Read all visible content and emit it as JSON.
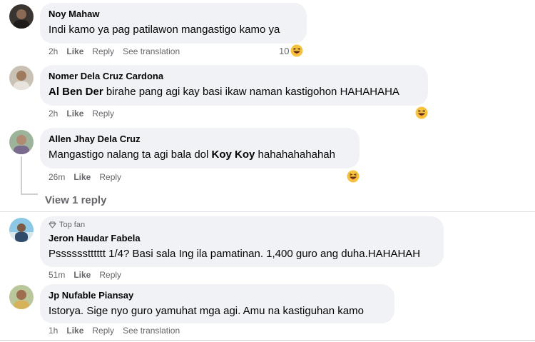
{
  "comments": [
    {
      "author": "Noy Mahaw",
      "text": "Indi kamo ya pag patilawon mangastigo kamo ya",
      "time": "2h",
      "like": "Like",
      "reply": "Reply",
      "see_translation": "See translation",
      "reaction_count": "10",
      "reaction_icon": "haha-icon"
    },
    {
      "author": "Nomer Dela Cruz Cardona",
      "mention": "Al Ben Der",
      "text": " birahe pang agi kay basi ikaw naman kastigohon HAHAHAHA",
      "time": "2h",
      "like": "Like",
      "reply": "Reply",
      "reaction_icon": "haha-icon"
    },
    {
      "author": "Allen Jhay Dela Cruz",
      "text": "Mangastigo nalang ta agi bala dol ",
      "mention": "Koy Koy",
      "text_after": " hahahahahahah",
      "time": "26m",
      "like": "Like",
      "reply": "Reply",
      "reaction_icon": "haha-icon",
      "view_replies": "View 1 reply"
    },
    {
      "badge": "Top fan",
      "badge_icon": "diamond-icon",
      "author": "Jeron Haudar Fabela",
      "text": "Psssssstttttt 1/4? Basi sala Ing ila pamatinan. 1,400 guro ang duha.HAHAHAH",
      "time": "51m",
      "like": "Like",
      "reply": "Reply"
    },
    {
      "author": "Jp Nufable Piansay",
      "text": "Istorya. Sige nyo guro yamuhat mga agi. Amu na kastiguhan kamo",
      "time": "1h",
      "like": "Like",
      "reply": "Reply",
      "see_translation": "See translation"
    }
  ],
  "colors": {
    "bubble": "#f0f2f5",
    "meta": "#65676b",
    "text": "#050505"
  }
}
